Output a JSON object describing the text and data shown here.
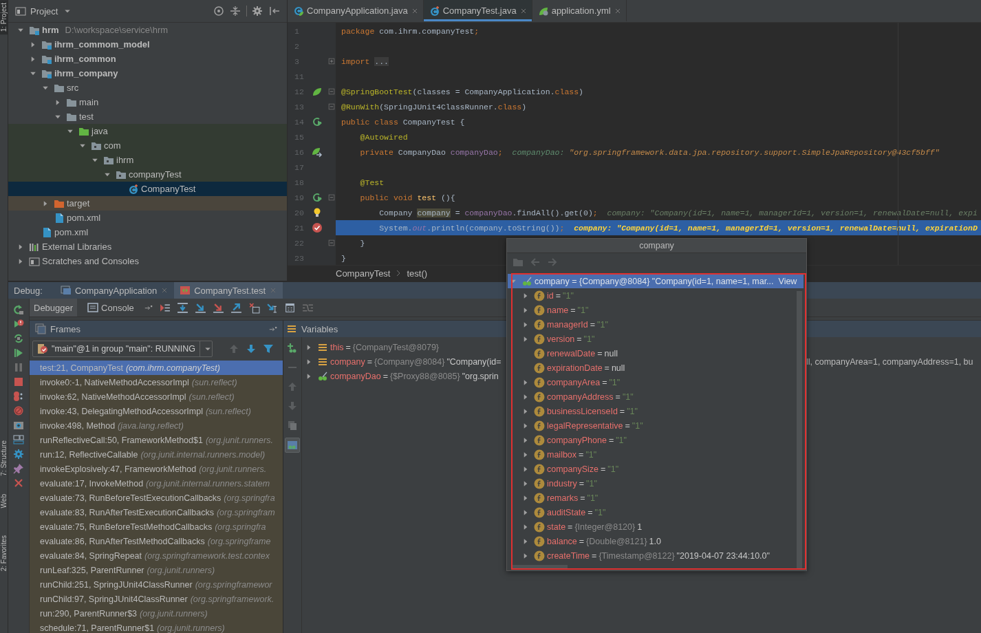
{
  "tool_strip": [
    {
      "label": "1: Project",
      "selected": true
    },
    {
      "label": "7: Structure",
      "selected": false
    },
    {
      "label": "Web",
      "selected": false
    },
    {
      "label": "2: Favorites",
      "selected": false
    }
  ],
  "project": {
    "title": "Project",
    "tree": [
      {
        "label": "hrm",
        "path": "D:\\workspace\\service\\hrm",
        "kind": "module",
        "expanded": true,
        "selected": false,
        "children": [
          {
            "label": "ihrm_commom_model",
            "kind": "module",
            "expanded": false,
            "selected": false
          },
          {
            "label": "ihrm_common",
            "kind": "module",
            "expanded": false,
            "selected": false
          },
          {
            "label": "ihrm_company",
            "kind": "module",
            "expanded": true,
            "selected": false,
            "children": [
              {
                "label": "src",
                "kind": "folder",
                "expanded": true,
                "selected": false,
                "children": [
                  {
                    "label": "main",
                    "kind": "folder",
                    "expanded": false,
                    "selected": false
                  },
                  {
                    "label": "test",
                    "kind": "folder",
                    "expanded": true,
                    "selected": false,
                    "children": [
                      {
                        "label": "java",
                        "kind": "test-source",
                        "expanded": true,
                        "selected": false,
                        "children": [
                          {
                            "label": "com",
                            "kind": "test-package",
                            "expanded": true,
                            "selected": false,
                            "children": [
                              {
                                "label": "ihrm",
                                "kind": "test-package",
                                "expanded": true,
                                "selected": false,
                                "children": [
                                  {
                                    "label": "companyTest",
                                    "kind": "test-package",
                                    "expanded": true,
                                    "selected": false,
                                    "children": [
                                      {
                                        "label": "CompanyTest",
                                        "kind": "test-class",
                                        "selected": true
                                      }
                                    ]
                                  }
                                ]
                              }
                            ]
                          }
                        ]
                      }
                    ]
                  }
                ]
              },
              {
                "label": "target",
                "kind": "excluded",
                "expanded": false,
                "selected": false
              },
              {
                "label": "pom.xml",
                "kind": "xml",
                "selected": false
              }
            ]
          },
          {
            "label": "pom.xml",
            "kind": "xml",
            "selected": false
          }
        ]
      },
      {
        "label": "External Libraries",
        "kind": "libraries",
        "expanded": false,
        "selected": false
      },
      {
        "label": "Scratches and Consoles",
        "kind": "scratches",
        "expanded": false,
        "selected": false
      }
    ]
  },
  "editor": {
    "tabs": [
      {
        "label": "CompanyApplication.java",
        "kind": "spring-class",
        "selected": false
      },
      {
        "label": "CompanyTest.java",
        "kind": "test-class",
        "selected": true
      },
      {
        "label": "application.yml",
        "kind": "spring-config",
        "selected": false
      }
    ],
    "lines": [
      {
        "number": "1",
        "current": false,
        "tokens": [
          {
            "text": "package ",
            "kind": "kw"
          },
          {
            "text": "com.ihrm.companyTest",
            "kind": "plain"
          },
          {
            "text": ";",
            "kind": "kw"
          }
        ]
      },
      {
        "number": "2",
        "current": false
      },
      {
        "number": "3",
        "current": false,
        "fold": {
          "kind": "collapsed"
        },
        "tokens": [
          {
            "text": "import ",
            "kind": "kw"
          },
          {
            "text": "...",
            "kind": "folded"
          }
        ]
      },
      {
        "number": "11",
        "current": false
      },
      {
        "number": "12",
        "current": false,
        "gutter": {
          "kind": "spring-bean"
        },
        "fold": {
          "kind": "open"
        },
        "tokens": [
          {
            "text": "@SpringBootTest",
            "kind": "ann"
          },
          {
            "text": "(classes = CompanyApplication.",
            "kind": "plain"
          },
          {
            "text": "class",
            "kind": "kw"
          },
          {
            "text": ")",
            "kind": "plain"
          }
        ]
      },
      {
        "number": "13",
        "current": false,
        "fold": {
          "kind": "open"
        },
        "tokens": [
          {
            "text": "@RunWith",
            "kind": "ann"
          },
          {
            "text": "(SpringJUnit4ClassRunner.",
            "kind": "plain"
          },
          {
            "text": "class",
            "kind": "kw"
          },
          {
            "text": ")",
            "kind": "plain"
          }
        ]
      },
      {
        "number": "14",
        "current": false,
        "gutter": {
          "kind": "run"
        },
        "tokens": [
          {
            "text": "public class ",
            "kind": "kw"
          },
          {
            "text": "CompanyTest {",
            "kind": "plain"
          }
        ]
      },
      {
        "number": "15",
        "current": false,
        "tokens": [
          {
            "text": "    @Autowired",
            "kind": "ann"
          }
        ]
      },
      {
        "number": "16",
        "current": false,
        "gutter": {
          "kind": "autowired"
        },
        "tokens": [
          {
            "text": "    private ",
            "kind": "kw"
          },
          {
            "text": "CompanyDao ",
            "kind": "plain"
          },
          {
            "text": "companyDao",
            "kind": "field"
          },
          {
            "text": ";",
            "kind": "kw"
          },
          {
            "text": "  companyDao: ",
            "kind": "hint-key"
          },
          {
            "text": "\"org.springframework.data.jpa.repository.support.SimpleJpaRepository@43cf5bff\"",
            "kind": "hint-str"
          }
        ]
      },
      {
        "number": "17",
        "current": false
      },
      {
        "number": "18",
        "current": false,
        "tokens": [
          {
            "text": "    @Test",
            "kind": "ann"
          }
        ]
      },
      {
        "number": "19",
        "current": false,
        "gutter": {
          "kind": "run"
        },
        "fold": {
          "kind": "open"
        },
        "tokens": [
          {
            "text": "    public void ",
            "kind": "kw"
          },
          {
            "text": "test",
            "kind": "method"
          },
          {
            "text": " (){",
            "kind": "plain"
          }
        ]
      },
      {
        "number": "20",
        "current": false,
        "gutter": {
          "kind": "bulb"
        },
        "tokens": [
          {
            "text": "        Company ",
            "kind": "plain"
          },
          {
            "text": "company",
            "kind": "usage"
          },
          {
            "text": " = ",
            "kind": "plain"
          },
          {
            "text": "companyDao",
            "kind": "field"
          },
          {
            "text": ".findAll().get(0)",
            "kind": "plain"
          },
          {
            "text": ";",
            "kind": "kw"
          },
          {
            "text": "  company: \"Company(id=1, name=1, managerId=1, version=1, renewalDate=null, expi",
            "kind": "hint"
          }
        ]
      },
      {
        "number": "21",
        "current": true,
        "gutter": {
          "kind": "breakpoint"
        },
        "tokens": [
          {
            "text": "        System.",
            "kind": "plain"
          },
          {
            "text": "out",
            "kind": "static"
          },
          {
            "text": ".println(company.toString())",
            "kind": "plain"
          },
          {
            "text": ";",
            "kind": "kw"
          },
          {
            "text": "  company: \"Company(id=1, name=1, managerId=1, version=1, renewalDate=null, expirationD",
            "kind": "hint-cur"
          }
        ]
      },
      {
        "number": "22",
        "current": false,
        "fold": {
          "kind": "close"
        },
        "tokens": [
          {
            "text": "    }",
            "kind": "plain"
          }
        ]
      },
      {
        "number": "23",
        "current": false,
        "tokens": [
          {
            "text": "}",
            "kind": "plain"
          }
        ]
      }
    ],
    "breadcrumbs": [
      "CompanyTest",
      "test()"
    ]
  },
  "debug": {
    "label": "Debug:",
    "sessions": [
      {
        "label": "CompanyApplication",
        "kind": "app",
        "selected": false
      },
      {
        "label": "CompanyTest.test",
        "kind": "test",
        "selected": true
      }
    ],
    "tabs": [
      {
        "label": "Debugger",
        "kind": "debugger",
        "selected": true
      },
      {
        "label": "Console",
        "kind": "console",
        "selected": false
      }
    ],
    "frames": {
      "title": "Frames",
      "thread": "\"main\"@1 in group \"main\": RUNNING",
      "items": [
        {
          "method": "test:21, CompanyTest",
          "location": "(com.ihrm.companyTest)",
          "selected": true
        },
        {
          "method": "invoke0:-1, NativeMethodAccessorImpl",
          "location": "(sun.reflect)",
          "selected": false
        },
        {
          "method": "invoke:62, NativeMethodAccessorImpl",
          "location": "(sun.reflect)",
          "selected": false
        },
        {
          "method": "invoke:43, DelegatingMethodAccessorImpl",
          "location": "(sun.reflect)",
          "selected": false
        },
        {
          "method": "invoke:498, Method",
          "location": "(java.lang.reflect)",
          "selected": false
        },
        {
          "method": "runReflectiveCall:50, FrameworkMethod$1",
          "location": "(org.junit.runners.",
          "selected": false
        },
        {
          "method": "run:12, ReflectiveCallable",
          "location": "(org.junit.internal.runners.model)",
          "selected": false
        },
        {
          "method": "invokeExplosively:47, FrameworkMethod",
          "location": "(org.junit.runners.",
          "selected": false
        },
        {
          "method": "evaluate:17, InvokeMethod",
          "location": "(org.junit.internal.runners.statem",
          "selected": false
        },
        {
          "method": "evaluate:73, RunBeforeTestExecutionCallbacks",
          "location": "(org.springfra",
          "selected": false
        },
        {
          "method": "evaluate:83, RunAfterTestExecutionCallbacks",
          "location": "(org.springfram",
          "selected": false
        },
        {
          "method": "evaluate:75, RunBeforeTestMethodCallbacks",
          "location": "(org.springfra",
          "selected": false
        },
        {
          "method": "evaluate:86, RunAfterTestMethodCallbacks",
          "location": "(org.springframe",
          "selected": false
        },
        {
          "method": "evaluate:84, SpringRepeat",
          "location": "(org.springframework.test.contex",
          "selected": false
        },
        {
          "method": "runLeaf:325, ParentRunner",
          "location": "(org.junit.runners)",
          "selected": false
        },
        {
          "method": "runChild:251, SpringJUnit4ClassRunner",
          "location": "(org.springframewor",
          "selected": false
        },
        {
          "method": "runChild:97, SpringJUnit4ClassRunner",
          "location": "(org.springframework.",
          "selected": false
        },
        {
          "method": "run:290, ParentRunner$3",
          "location": "(org.junit.runners)",
          "selected": false
        },
        {
          "method": "schedule:71, ParentRunner$1",
          "location": "(org.junit.runners)",
          "selected": false
        }
      ]
    },
    "variables": {
      "title": "Variables",
      "items": [
        {
          "name": "this",
          "operator": "=",
          "ref": "{CompanyTest@8079}",
          "kind": "object"
        },
        {
          "name": "company",
          "operator": "=",
          "ref": "{Company@8084}",
          "value": "\"Company(id=",
          "tail": "ll, companyArea=1, companyAddress=1, bu",
          "kind": "object"
        },
        {
          "name": "companyDao",
          "operator": "=",
          "ref": "{$Proxy88@8085}",
          "value": "\"org.sprin",
          "kind": "watch"
        }
      ]
    }
  },
  "popup": {
    "title": "company",
    "root": {
      "name": "company",
      "operator": "=",
      "ref": "{Company@8084}",
      "value": "\"Company(id=1, name=1, mar...",
      "link": "View",
      "expanded": true,
      "selected": true
    },
    "fields": [
      {
        "name": "id",
        "operator": "=",
        "value": "\"1\"",
        "kind": "string",
        "expandable": true
      },
      {
        "name": "name",
        "operator": "=",
        "value": "\"1\"",
        "kind": "string",
        "expandable": true
      },
      {
        "name": "managerId",
        "operator": "=",
        "value": "\"1\"",
        "kind": "string",
        "expandable": true
      },
      {
        "name": "version",
        "operator": "=",
        "value": "\"1\"",
        "kind": "string",
        "expandable": true
      },
      {
        "name": "renewalDate",
        "operator": "=",
        "value": "null",
        "kind": "plain",
        "expandable": false
      },
      {
        "name": "expirationDate",
        "operator": "=",
        "value": "null",
        "kind": "plain",
        "expandable": false
      },
      {
        "name": "companyArea",
        "operator": "=",
        "value": "\"1\"",
        "kind": "string",
        "expandable": true
      },
      {
        "name": "companyAddress",
        "operator": "=",
        "value": "\"1\"",
        "kind": "string",
        "expandable": true
      },
      {
        "name": "businessLicenseId",
        "operator": "=",
        "value": "\"1\"",
        "kind": "string",
        "expandable": true
      },
      {
        "name": "legalRepresentative",
        "operator": "=",
        "value": "\"1\"",
        "kind": "string",
        "expandable": true
      },
      {
        "name": "companyPhone",
        "operator": "=",
        "value": "\"1\"",
        "kind": "string",
        "expandable": true
      },
      {
        "name": "mailbox",
        "operator": "=",
        "value": "\"1\"",
        "kind": "string",
        "expandable": true
      },
      {
        "name": "companySize",
        "operator": "=",
        "value": "\"1\"",
        "kind": "string",
        "expandable": true
      },
      {
        "name": "industry",
        "operator": "=",
        "value": "\"1\"",
        "kind": "string",
        "expandable": true
      },
      {
        "name": "remarks",
        "operator": "=",
        "value": "\"1\"",
        "kind": "string",
        "expandable": true
      },
      {
        "name": "auditState",
        "operator": "=",
        "value": "\"1\"",
        "kind": "string",
        "expandable": true
      },
      {
        "name": "state",
        "operator": "=",
        "ref": "{Integer@8120}",
        "value": "1",
        "kind": "plain",
        "expandable": true
      },
      {
        "name": "balance",
        "operator": "=",
        "ref": "{Double@8121}",
        "value": "1.0",
        "kind": "plain",
        "expandable": true
      },
      {
        "name": "createTime",
        "operator": "=",
        "ref": "{Timestamp@8122}",
        "value": "\"2019-04-07 23:44:10.0\"",
        "kind": "plain",
        "expandable": true
      }
    ]
  }
}
